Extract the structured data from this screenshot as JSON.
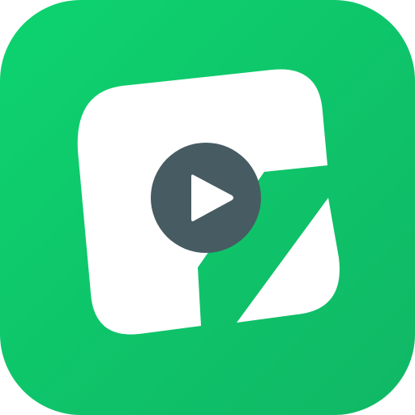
{
  "app_icon": {
    "icon_name": "video-editor-app-icon",
    "colors": {
      "background_top": "#0dd36f",
      "background_bottom": "#10b765",
      "card": "#ffffff",
      "play_circle": "#475b62",
      "play_triangle": "#ffffff"
    }
  }
}
